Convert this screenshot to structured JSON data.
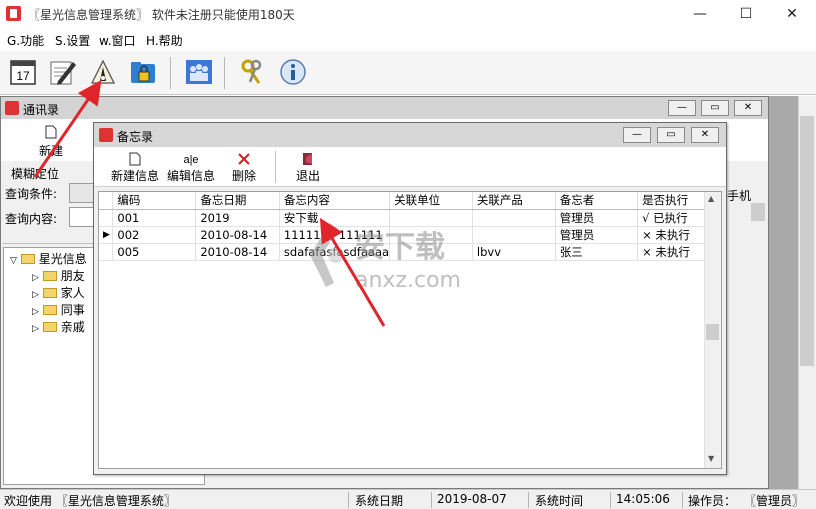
{
  "app": {
    "title": "〖星光信息管理系统〗 软件未注册只能使用180天",
    "window_controls": {
      "minimize": "—",
      "maximize": "☐",
      "close": "✕"
    }
  },
  "menu": [
    {
      "label": "G.功能"
    },
    {
      "label": "S.设置"
    },
    {
      "label": "w.窗口"
    },
    {
      "label": "H.帮助"
    }
  ],
  "toolbar": {
    "icons": [
      "calendar-icon",
      "edit-icon",
      "memo-icon",
      "lock-folder-icon",
      "users-icon",
      "keys-icon",
      "info-icon"
    ]
  },
  "contacts_window": {
    "title": "通讯录",
    "new_label": "新建",
    "fuzzy_locate": "模糊定位",
    "query_condition": "查询条件:",
    "query_content": "查询内容:",
    "tree": {
      "root": "星光信息",
      "children": [
        "朋友",
        "家人",
        "同事",
        "亲戚"
      ]
    },
    "partial_header": "手机"
  },
  "memo_window": {
    "title": "备忘录",
    "toolbar": {
      "new": "新建信息",
      "edit": "编辑信息",
      "delete": "删除",
      "exit": "退出"
    },
    "columns": [
      "编码",
      "备忘日期",
      "备忘内容",
      "关联单位",
      "关联产品",
      "备忘者",
      "是否执行"
    ],
    "rows": [
      {
        "code": "001",
        "date": "2019",
        "content": "安下载",
        "unit": "",
        "product": "",
        "by": "管理员",
        "done": "√ 已执行",
        "selected": false
      },
      {
        "code": "002",
        "date": "2010-08-14",
        "content": "1111111 111111",
        "unit": "",
        "product": "",
        "by": "管理员",
        "done": "× 未执行",
        "selected": true
      },
      {
        "code": "005",
        "date": "2010-08-14",
        "content": "sdafafasfasdfaaaa",
        "unit": "",
        "product": "lbvv",
        "by": "张三",
        "done": "× 未执行",
        "selected": false
      }
    ]
  },
  "watermark": {
    "brand": "安下载",
    "domain": "anxz.com"
  },
  "statusbar": {
    "welcome": "欢迎使用 〖星光信息管理系统〗",
    "date_label": "系统日期",
    "date_value": "2019-08-07",
    "time_label": "系统时间",
    "time_value": "14:05:06",
    "operator_label": "操作员：",
    "operator_value": "〖管理员〗"
  },
  "colors": {
    "arrow": "#e0262c",
    "app_icon": "#d33333"
  }
}
